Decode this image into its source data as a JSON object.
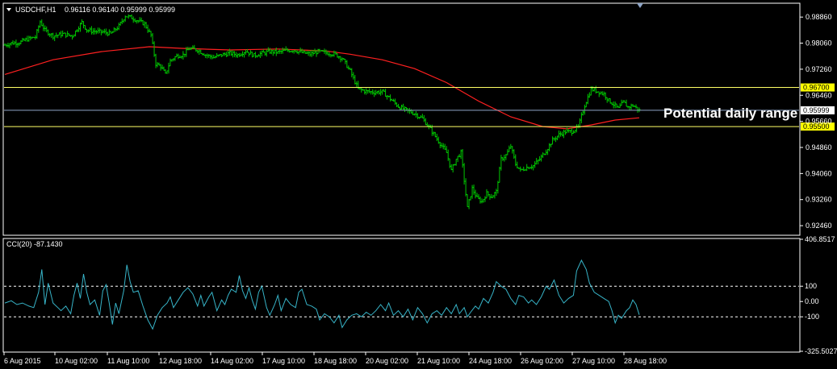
{
  "header": {
    "symbol": "USDCHF,H1",
    "ohlc": "0.96116 0.96140 0.95999 0.95999"
  },
  "annotation": "Potential daily range",
  "colors": {
    "background": "#000000",
    "price_bars": "#00c800",
    "moving_average": "#ff2020",
    "range_lines": "#ffff66",
    "current_price_line": "#8fa6c8",
    "cci_line": "#37b4c8",
    "frame": "#ffffff"
  },
  "chart_data": [
    {
      "type": "bar",
      "subtype": "ohlc",
      "x_ticks": [
        "6 Aug 2015",
        "10 Aug 02:00",
        "11 Aug 10:00",
        "12 Aug 18:00",
        "14 Aug 02:00",
        "17 Aug 10:00",
        "18 Aug 18:00",
        "20 Aug 02:00",
        "21 Aug 10:00",
        "24 Aug 18:00",
        "26 Aug 02:00",
        "27 Aug 10:00",
        "28 Aug 18:00"
      ],
      "y_ticks": [
        "0.98860",
        "0.98060",
        "0.97260",
        "0.96460",
        "0.95660",
        "0.94860",
        "0.94060",
        "0.93260",
        "0.92460"
      ],
      "ylim": [
        0.9219,
        0.9926
      ],
      "close_path": [
        [
          0,
          0.98
        ],
        [
          8,
          0.9806
        ],
        [
          18,
          0.9808
        ],
        [
          28,
          0.9818
        ],
        [
          38,
          0.9825
        ],
        [
          44,
          0.9872
        ],
        [
          50,
          0.9845
        ],
        [
          60,
          0.9828
        ],
        [
          72,
          0.9834
        ],
        [
          84,
          0.9828
        ],
        [
          96,
          0.987
        ],
        [
          102,
          0.9846
        ],
        [
          112,
          0.9842
        ],
        [
          122,
          0.984
        ],
        [
          132,
          0.9835
        ],
        [
          142,
          0.9858
        ],
        [
          150,
          0.989
        ],
        [
          158,
          0.9884
        ],
        [
          166,
          0.9874
        ],
        [
          174,
          0.9865
        ],
        [
          182,
          0.983
        ],
        [
          188,
          0.9742
        ],
        [
          194,
          0.9735
        ],
        [
          200,
          0.971
        ],
        [
          206,
          0.9752
        ],
        [
          214,
          0.9767
        ],
        [
          222,
          0.977
        ],
        [
          230,
          0.979
        ],
        [
          240,
          0.9785
        ],
        [
          250,
          0.977
        ],
        [
          260,
          0.9762
        ],
        [
          270,
          0.977
        ],
        [
          280,
          0.9775
        ],
        [
          290,
          0.977
        ],
        [
          300,
          0.9782
        ],
        [
          310,
          0.9768
        ],
        [
          320,
          0.9775
        ],
        [
          330,
          0.978
        ],
        [
          340,
          0.9778
        ],
        [
          350,
          0.9783
        ],
        [
          360,
          0.9785
        ],
        [
          370,
          0.9777
        ],
        [
          380,
          0.9772
        ],
        [
          390,
          0.978
        ],
        [
          400,
          0.9776
        ],
        [
          410,
          0.9773
        ],
        [
          420,
          0.976
        ],
        [
          430,
          0.972
        ],
        [
          440,
          0.9665
        ],
        [
          450,
          0.9658
        ],
        [
          460,
          0.9655
        ],
        [
          470,
          0.9657
        ],
        [
          480,
          0.9635
        ],
        [
          490,
          0.9612
        ],
        [
          500,
          0.96
        ],
        [
          510,
          0.959
        ],
        [
          520,
          0.9575
        ],
        [
          530,
          0.9542
        ],
        [
          540,
          0.9505
        ],
        [
          550,
          0.947
        ],
        [
          556,
          0.9415
        ],
        [
          562,
          0.945
        ],
        [
          568,
          0.947
        ],
        [
          576,
          0.93
        ],
        [
          582,
          0.936
        ],
        [
          588,
          0.933
        ],
        [
          594,
          0.932
        ],
        [
          600,
          0.9345
        ],
        [
          606,
          0.9335
        ],
        [
          612,
          0.935
        ],
        [
          618,
          0.945
        ],
        [
          624,
          0.9462
        ],
        [
          630,
          0.949
        ],
        [
          636,
          0.9435
        ],
        [
          642,
          0.9415
        ],
        [
          650,
          0.9425
        ],
        [
          658,
          0.943
        ],
        [
          666,
          0.945
        ],
        [
          674,
          0.9476
        ],
        [
          682,
          0.9508
        ],
        [
          690,
          0.9525
        ],
        [
          698,
          0.9534
        ],
        [
          706,
          0.9535
        ],
        [
          714,
          0.9548
        ],
        [
          722,
          0.9615
        ],
        [
          730,
          0.9665
        ],
        [
          738,
          0.9658
        ],
        [
          746,
          0.965
        ],
        [
          752,
          0.963
        ],
        [
          758,
          0.9618
        ],
        [
          764,
          0.9605
        ],
        [
          770,
          0.9625
        ],
        [
          776,
          0.961
        ],
        [
          782,
          0.9615
        ],
        [
          790,
          0.96
        ]
      ],
      "moving_average": [
        [
          0,
          0.971
        ],
        [
          60,
          0.9755
        ],
        [
          120,
          0.978
        ],
        [
          180,
          0.9795
        ],
        [
          220,
          0.979
        ],
        [
          280,
          0.9785
        ],
        [
          340,
          0.9788
        ],
        [
          400,
          0.9782
        ],
        [
          430,
          0.9772
        ],
        [
          470,
          0.9755
        ],
        [
          510,
          0.9728
        ],
        [
          550,
          0.9685
        ],
        [
          590,
          0.9628
        ],
        [
          630,
          0.958
        ],
        [
          670,
          0.955
        ],
        [
          700,
          0.9543
        ],
        [
          730,
          0.9555
        ],
        [
          760,
          0.957
        ],
        [
          790,
          0.9577
        ]
      ],
      "lines": [
        {
          "name": "0.96700",
          "value": 0.967,
          "label": "0.96700"
        },
        {
          "name": "0.95500",
          "value": 0.955,
          "label": "0.95500"
        },
        {
          "name": "current",
          "value": 0.95999,
          "label": "0.95999"
        }
      ]
    },
    {
      "type": "line",
      "title": "CCI(20) -87.1430",
      "ylim": [
        -325.5027,
        406.8517
      ],
      "y_ticks": [
        "406.8517",
        "100",
        "0.00",
        "-100",
        "-325.5027"
      ],
      "levels": [
        100,
        -100
      ],
      "values": [
        [
          0,
          -10
        ],
        [
          8,
          5
        ],
        [
          15,
          -20
        ],
        [
          22,
          -10
        ],
        [
          30,
          -30
        ],
        [
          36,
          -40
        ],
        [
          42,
          60
        ],
        [
          46,
          210
        ],
        [
          50,
          -20
        ],
        [
          54,
          120
        ],
        [
          60,
          -10
        ],
        [
          66,
          -40
        ],
        [
          70,
          -60
        ],
        [
          76,
          -30
        ],
        [
          82,
          -80
        ],
        [
          86,
          40
        ],
        [
          90,
          120
        ],
        [
          94,
          20
        ],
        [
          98,
          180
        ],
        [
          102,
          60
        ],
        [
          106,
          -20
        ],
        [
          112,
          10
        ],
        [
          118,
          -90
        ],
        [
          122,
          70
        ],
        [
          126,
          110
        ],
        [
          130,
          -10
        ],
        [
          134,
          -150
        ],
        [
          138,
          -10
        ],
        [
          142,
          -80
        ],
        [
          148,
          70
        ],
        [
          152,
          240
        ],
        [
          156,
          130
        ],
        [
          160,
          60
        ],
        [
          166,
          70
        ],
        [
          172,
          -30
        ],
        [
          178,
          -120
        ],
        [
          184,
          -180
        ],
        [
          190,
          -90
        ],
        [
          196,
          -40
        ],
        [
          202,
          -10
        ],
        [
          206,
          30
        ],
        [
          210,
          -40
        ],
        [
          216,
          10
        ],
        [
          222,
          60
        ],
        [
          228,
          90
        ],
        [
          234,
          50
        ],
        [
          240,
          -30
        ],
        [
          244,
          40
        ],
        [
          248,
          -30
        ],
        [
          254,
          30
        ],
        [
          258,
          60
        ],
        [
          264,
          -60
        ],
        [
          270,
          10
        ],
        [
          274,
          -20
        ],
        [
          278,
          40
        ],
        [
          282,
          80
        ],
        [
          288,
          60
        ],
        [
          292,
          170
        ],
        [
          296,
          70
        ],
        [
          300,
          20
        ],
        [
          304,
          90
        ],
        [
          308,
          10
        ],
        [
          312,
          -50
        ],
        [
          316,
          60
        ],
        [
          320,
          100
        ],
        [
          326,
          -40
        ],
        [
          330,
          -90
        ],
        [
          336,
          -20
        ],
        [
          340,
          40
        ],
        [
          344,
          -60
        ],
        [
          350,
          20
        ],
        [
          356,
          -20
        ],
        [
          362,
          -40
        ],
        [
          366,
          60
        ],
        [
          370,
          80
        ],
        [
          376,
          -20
        ],
        [
          382,
          -30
        ],
        [
          388,
          -50
        ],
        [
          392,
          -120
        ],
        [
          398,
          -80
        ],
        [
          404,
          -100
        ],
        [
          410,
          -140
        ],
        [
          416,
          -90
        ],
        [
          420,
          -170
        ],
        [
          426,
          -120
        ],
        [
          432,
          -90
        ],
        [
          438,
          -80
        ],
        [
          444,
          -100
        ],
        [
          450,
          -70
        ],
        [
          456,
          -90
        ],
        [
          462,
          -60
        ],
        [
          468,
          -20
        ],
        [
          474,
          -60
        ],
        [
          478,
          -10
        ],
        [
          484,
          -90
        ],
        [
          490,
          -60
        ],
        [
          496,
          -100
        ],
        [
          502,
          -50
        ],
        [
          508,
          -120
        ],
        [
          514,
          -40
        ],
        [
          520,
          -80
        ],
        [
          526,
          -140
        ],
        [
          532,
          -80
        ],
        [
          538,
          -60
        ],
        [
          544,
          -90
        ],
        [
          550,
          -40
        ],
        [
          556,
          -80
        ],
        [
          562,
          -20
        ],
        [
          566,
          -80
        ],
        [
          572,
          -40
        ],
        [
          576,
          -100
        ],
        [
          580,
          -70
        ],
        [
          586,
          -30
        ],
        [
          590,
          -50
        ],
        [
          596,
          20
        ],
        [
          602,
          -10
        ],
        [
          608,
          60
        ],
        [
          612,
          130
        ],
        [
          618,
          100
        ],
        [
          624,
          80
        ],
        [
          630,
          20
        ],
        [
          636,
          -20
        ],
        [
          640,
          40
        ],
        [
          646,
          30
        ],
        [
          652,
          -10
        ],
        [
          656,
          10
        ],
        [
          662,
          -20
        ],
        [
          668,
          30
        ],
        [
          674,
          100
        ],
        [
          678,
          80
        ],
        [
          684,
          140
        ],
        [
          690,
          40
        ],
        [
          696,
          -10
        ],
        [
          702,
          20
        ],
        [
          708,
          40
        ],
        [
          712,
          200
        ],
        [
          718,
          270
        ],
        [
          724,
          210
        ],
        [
          728,
          120
        ],
        [
          734,
          60
        ],
        [
          740,
          40
        ],
        [
          746,
          20
        ],
        [
          752,
          0
        ],
        [
          756,
          -60
        ],
        [
          760,
          -140
        ],
        [
          764,
          -90
        ],
        [
          768,
          -110
        ],
        [
          774,
          -60
        ],
        [
          778,
          -40
        ],
        [
          782,
          10
        ],
        [
          786,
          -20
        ],
        [
          790,
          -87
        ]
      ]
    }
  ]
}
